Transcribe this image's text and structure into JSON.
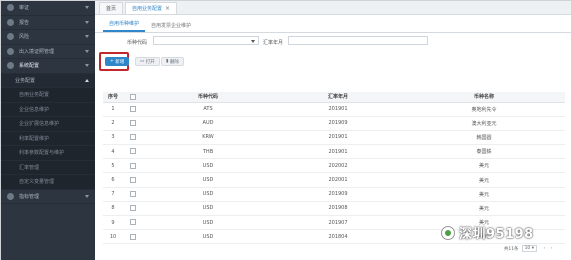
{
  "sidebar": {
    "items": [
      {
        "label": "审证"
      },
      {
        "label": "报告"
      },
      {
        "label": "风险"
      },
      {
        "label": "出入境证照管理"
      },
      {
        "label": "系统配置"
      }
    ],
    "section": {
      "label": "业务配置"
    },
    "active": {
      "label": "自用业务配置"
    },
    "children": [
      {
        "label": "企业信息维护"
      },
      {
        "label": "企业扩展信息维护"
      },
      {
        "label": "利率配置维护"
      },
      {
        "label": "利率参数配置与维护"
      },
      {
        "label": "汇率管理"
      },
      {
        "label": "自定义变量管理"
      },
      {
        "label": "指标管理"
      }
    ]
  },
  "topbar": {
    "tabs": [
      {
        "label": "首页"
      },
      {
        "label": "自用业务配置"
      }
    ]
  },
  "subtabs": [
    {
      "label": "自用币种维护"
    },
    {
      "label": "自用发票企业维护"
    }
  ],
  "filters": {
    "currency_label": "币种代码",
    "month_label": "汇率年月"
  },
  "toolbar": {
    "new_label": "新增",
    "open_label": "打开",
    "delete_label": "删除"
  },
  "table": {
    "headers": [
      "序号",
      "",
      "币种代码",
      "汇率年月",
      "币种名称"
    ],
    "rows": [
      {
        "no": "1",
        "code": "ATS",
        "month": "201901",
        "name": "奥地利先令"
      },
      {
        "no": "2",
        "code": "AUD",
        "month": "201909",
        "name": "澳大利亚元"
      },
      {
        "no": "3",
        "code": "KRW",
        "month": "201901",
        "name": "韩国圆"
      },
      {
        "no": "4",
        "code": "THB",
        "month": "201901",
        "name": "泰国铢"
      },
      {
        "no": "5",
        "code": "USD",
        "month": "202002",
        "name": "美元"
      },
      {
        "no": "6",
        "code": "USD",
        "month": "202001",
        "name": "美元"
      },
      {
        "no": "7",
        "code": "USD",
        "month": "201909",
        "name": "美元"
      },
      {
        "no": "8",
        "code": "USD",
        "month": "201908",
        "name": "美元"
      },
      {
        "no": "9",
        "code": "USD",
        "month": "201907",
        "name": "美元"
      },
      {
        "no": "10",
        "code": "USD",
        "month": "201804",
        "name": "美元"
      }
    ]
  },
  "pager": {
    "total": "共11条",
    "page_size": "10"
  },
  "watermark": {
    "text": "深圳95198"
  },
  "colors": {
    "accent": "#2f86c8",
    "sidebar": "#2d3540",
    "highlight": "#c0282e"
  }
}
